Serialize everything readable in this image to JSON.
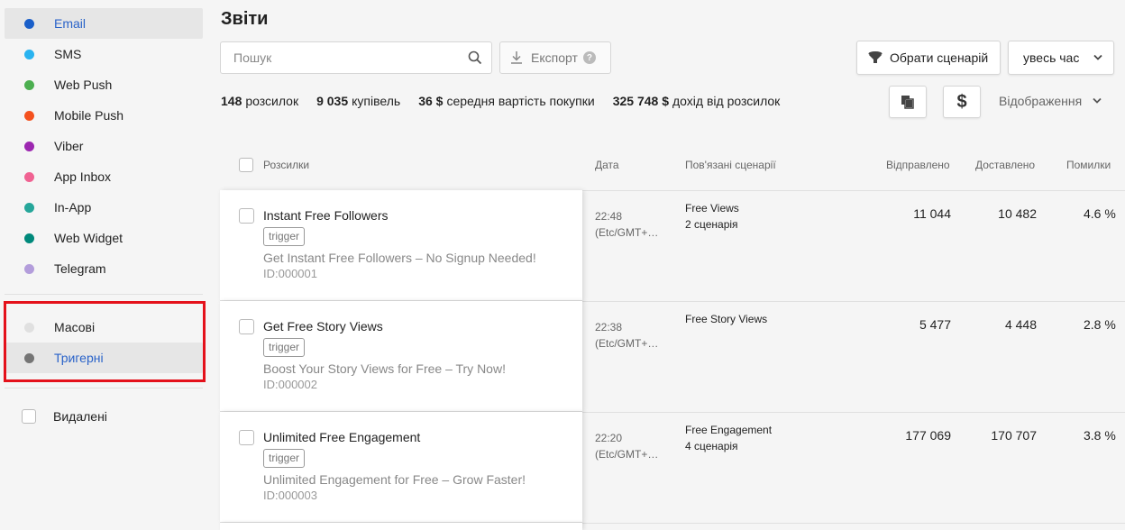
{
  "sidebar": {
    "channels": [
      {
        "label": "Email",
        "color": "#1a5fc9",
        "active": true
      },
      {
        "label": "SMS",
        "color": "#29b3f0"
      },
      {
        "label": "Web Push",
        "color": "#4caf50"
      },
      {
        "label": "Mobile Push",
        "color": "#f4511e"
      },
      {
        "label": "Viber",
        "color": "#9c27b0"
      },
      {
        "label": "App Inbox",
        "color": "#f06292"
      },
      {
        "label": "In-App",
        "color": "#26a69a"
      },
      {
        "label": "Web Widget",
        "color": "#00897b"
      },
      {
        "label": "Telegram",
        "color": "#b39ddb"
      }
    ],
    "types": [
      {
        "label": "Масові",
        "color": "#e0e0e0"
      },
      {
        "label": "Тригерні",
        "color": "#757575",
        "active": true
      }
    ],
    "deleted_label": "Видалені"
  },
  "header": {
    "title": "Звіти",
    "search_placeholder": "Пошук",
    "export_label": "Експорт",
    "help_glyph": "?",
    "scenario_label": "Обрати сценарій",
    "period_value": "увесь час",
    "currency_glyph": "$",
    "display_label": "Відображення"
  },
  "stats": [
    {
      "value": "148",
      "label": "розсилок"
    },
    {
      "value": "9 035",
      "label": "купівель"
    },
    {
      "value": "36 $",
      "label": "середня вартість покупки"
    },
    {
      "value": "325 748 $",
      "label": "дохід від розсилок"
    }
  ],
  "table": {
    "columns": {
      "campaigns": "Розсилки",
      "date": "Дата",
      "scenarios": "Пов'язані сценарії",
      "sent": "Відправлено",
      "delivered": "Доставлено",
      "errors": "Помилки"
    },
    "rows": [
      {
        "name": "Instant Free Followers",
        "tag": "trigger",
        "subject": "Get Instant Free Followers – No Signup Needed!",
        "id": "ID:000001",
        "time": "22:48",
        "tz": "(Etc/GMT+…",
        "scenario": "Free Views",
        "scenario_count": "2 сценарія",
        "sent": "11 044",
        "delivered": "10 482",
        "errors": "4.6 %"
      },
      {
        "name": "Get Free Story Views",
        "tag": "trigger",
        "subject": "Boost Your Story Views for Free – Try Now!",
        "id": "ID:000002",
        "time": "22:38",
        "tz": "(Etc/GMT+…",
        "scenario": "Free Story Views",
        "scenario_count": "",
        "sent": "5 477",
        "delivered": "4 448",
        "errors": "2.8 %"
      },
      {
        "name": "Unlimited Free Engagement",
        "tag": "trigger",
        "subject": "Unlimited Engagement for Free – Grow Faster!",
        "id": "ID:000003",
        "time": "22:20",
        "tz": "(Etc/GMT+…",
        "scenario": "Free Engagement",
        "scenario_count": "4 сценарія",
        "sent": "177 069",
        "delivered": "170 707",
        "errors": "3.8 %"
      }
    ]
  }
}
